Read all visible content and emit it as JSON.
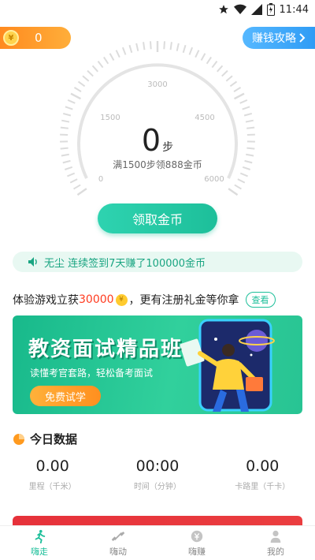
{
  "status_bar": {
    "time": "11:44",
    "icons": [
      "star-icon",
      "wifi-icon",
      "signal-icon",
      "battery-icon"
    ]
  },
  "header": {
    "coin_count": "0",
    "coin_symbol": "¥",
    "earn_guide_label": "赚钱攻略"
  },
  "gauge": {
    "ticks": [
      "0",
      "1500",
      "3000",
      "4500",
      "6000"
    ],
    "steps_value": "0",
    "steps_unit": "步",
    "hint": "满1500步领888金币"
  },
  "claim_button": "领取金币",
  "notice": "无尘 连续签到7天赚了100000金币",
  "promo": {
    "prefix": "体验游戏立获",
    "amount": "30000",
    "suffix": "，更有注册礼金等你拿",
    "view_label": "查看"
  },
  "banner": {
    "title": "教资面试精品班",
    "subtitle": "读懂考官套路，轻松备考面试",
    "button": "免费试学"
  },
  "today": {
    "title": "今日数据",
    "stats": [
      {
        "value": "0.00",
        "label": "里程（千米）"
      },
      {
        "value": "00:00",
        "label": "时间（分钟）"
      },
      {
        "value": "0.00",
        "label": "卡路里（千卡）"
      }
    ]
  },
  "tabs": [
    {
      "label": "嗨走",
      "icon": "runner-icon",
      "active": true
    },
    {
      "label": "嗨动",
      "icon": "dumbbell-icon",
      "active": false
    },
    {
      "label": "嗨赚",
      "icon": "coin-icon",
      "active": false
    },
    {
      "label": "我的",
      "icon": "person-icon",
      "active": false
    }
  ],
  "colors": {
    "accent": "#1dbf9a",
    "coin_pill": "#ff8a1f",
    "guide": "#2f9cf5",
    "promo_amount": "#ff3b1f",
    "red_strip": "#e6313a"
  }
}
